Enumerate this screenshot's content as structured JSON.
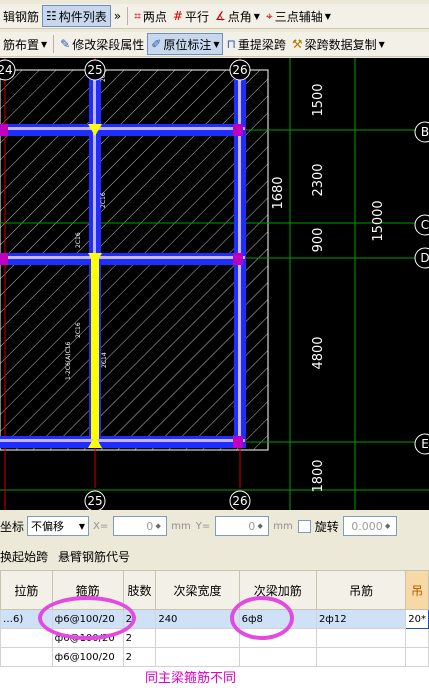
{
  "toolbar1": {
    "items": [
      "辑钢筋",
      "构件列表",
      "»",
      "两点",
      "平行",
      "点角",
      "三点辅轴"
    ]
  },
  "toolbar2": {
    "items": [
      "筋布置",
      "修改梁段属性",
      "原位标注",
      "重提梁跨",
      "梁跨数据复制"
    ]
  },
  "canvas": {
    "axis_top": [
      "24",
      "25",
      "26"
    ],
    "axis_bottom": [
      "25",
      "26"
    ],
    "axis_right": [
      "B",
      "C",
      "D",
      "E"
    ],
    "dims_right": [
      "1500",
      "2300",
      "900",
      "4800",
      "1800"
    ],
    "dim_total": "15000",
    "dim_small": "1680",
    "rebar_labels": [
      "2C16",
      "2C16",
      "2C16",
      "2C16",
      "1-2C6(A)C16",
      "2C14"
    ]
  },
  "coordbar": {
    "label": "坐标",
    "mode": "不偏移",
    "x_label": "X=",
    "x_value": "0",
    "y_label": "Y=",
    "y_value": "0",
    "unit": "mm",
    "rotate_label": "旋转",
    "rotate_value": "0.000"
  },
  "tabs": [
    "换起始跨",
    "悬臂钢筋代号"
  ],
  "grid": {
    "headers": [
      "拉筋",
      "箍筋",
      "肢数",
      "次梁宽度",
      "次梁加筋",
      "吊筋",
      "吊"
    ],
    "rows": [
      [
        "…6)",
        "ф6@100/20",
        "2",
        "240",
        "6ф8",
        "2ф12",
        "20*"
      ],
      [
        "",
        "ф6@100/20",
        "2",
        "",
        "",
        "",
        ""
      ],
      [
        "",
        "ф6@100/20",
        "2",
        "",
        "",
        "",
        ""
      ]
    ]
  },
  "annotation": "同主梁箍筋不同",
  "colors": {
    "highlight": "#e34ae0",
    "beam_blue": "#1e2eff",
    "beam_yellow": "#ffff00",
    "grid_green": "#00b000"
  }
}
